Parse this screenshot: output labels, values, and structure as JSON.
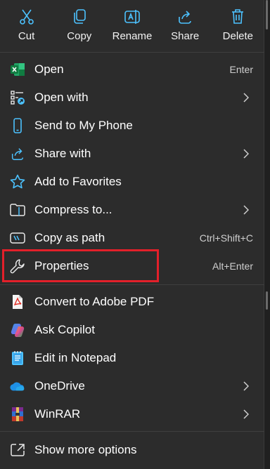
{
  "toolbar": {
    "cut": "Cut",
    "copy": "Copy",
    "rename": "Rename",
    "share": "Share",
    "delete": "Delete"
  },
  "items": {
    "open": {
      "label": "Open",
      "shortcut": "Enter"
    },
    "open_with": {
      "label": "Open with"
    },
    "send_phone": {
      "label": "Send to My Phone"
    },
    "share_with": {
      "label": "Share with"
    },
    "favorites": {
      "label": "Add to Favorites"
    },
    "compress": {
      "label": "Compress to..."
    },
    "copy_path": {
      "label": "Copy as path",
      "shortcut": "Ctrl+Shift+C"
    },
    "properties": {
      "label": "Properties",
      "shortcut": "Alt+Enter"
    },
    "adobe": {
      "label": "Convert to Adobe PDF"
    },
    "copilot": {
      "label": "Ask Copilot"
    },
    "notepad": {
      "label": "Edit in Notepad"
    },
    "onedrive": {
      "label": "OneDrive"
    },
    "winrar": {
      "label": "WinRAR"
    },
    "more": {
      "label": "Show more options"
    }
  },
  "colors": {
    "accent": "#4cc2ff",
    "highlight_border": "#e3202a",
    "background": "#2c2c2c"
  },
  "icons": {
    "cut": "scissors-icon",
    "copy": "copy-icon",
    "rename": "rename-icon",
    "share": "share-icon",
    "delete": "trash-icon",
    "open": "excel-icon",
    "open_with": "open-with-icon",
    "send_phone": "phone-icon",
    "share_with": "share-icon",
    "favorites": "star-icon",
    "compress": "folder-zip-icon",
    "copy_path": "copy-path-icon",
    "properties": "wrench-icon",
    "adobe": "pdf-icon",
    "copilot": "copilot-icon",
    "notepad": "notepad-icon",
    "onedrive": "cloud-icon",
    "winrar": "winrar-icon",
    "more": "show-more-icon"
  }
}
